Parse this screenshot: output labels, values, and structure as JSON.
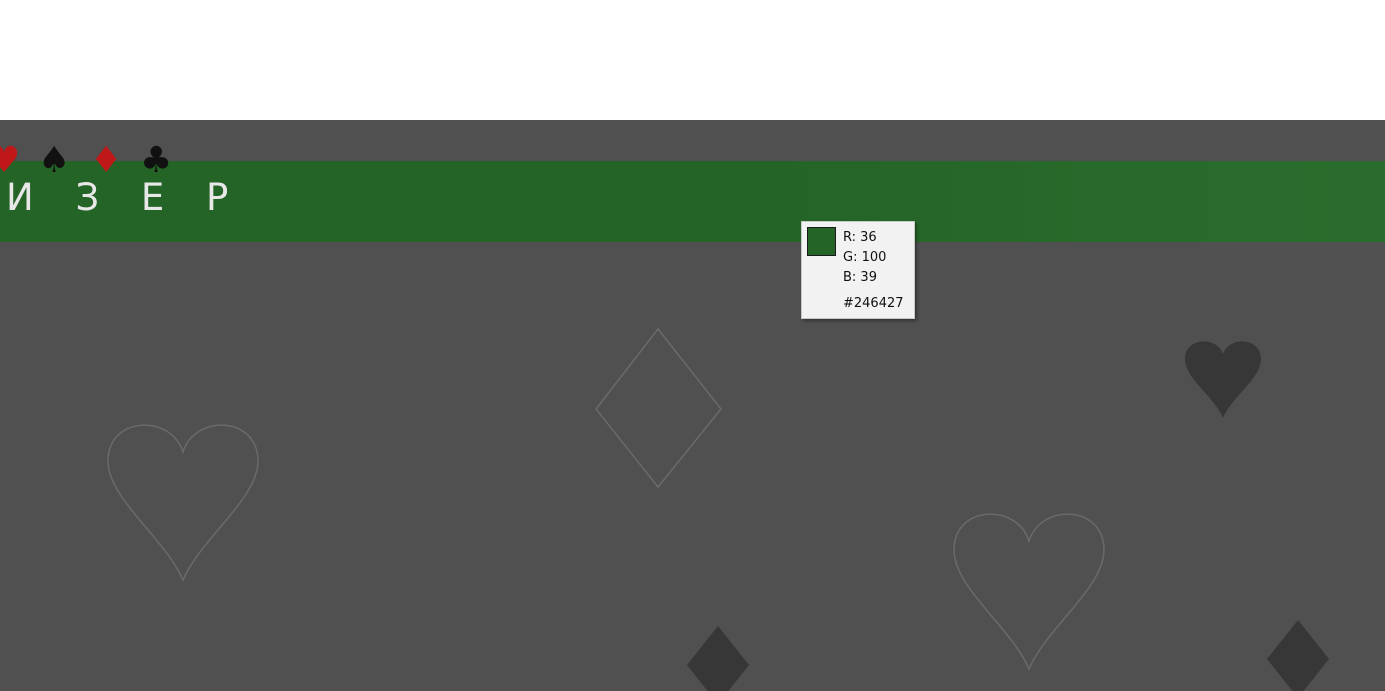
{
  "banner": {
    "title": "И З Е Р",
    "color": "#246427"
  },
  "suits_row": [
    {
      "icon": "heart-icon",
      "glyph": "♥",
      "color": "#c01818"
    },
    {
      "icon": "spade-icon",
      "glyph": "♠",
      "color": "#111111"
    },
    {
      "icon": "diamond-icon",
      "glyph": "♦",
      "color": "#c01818"
    },
    {
      "icon": "club-icon",
      "glyph": "♣",
      "color": "#111111"
    }
  ],
  "background": {
    "color": "#505050",
    "pattern_icons": [
      "heart-outline-icon",
      "diamond-outline-icon",
      "heart-outline-icon",
      "heart-icon",
      "diamond-icon",
      "diamond-icon"
    ]
  },
  "color_picker": {
    "r_label": "R: 36",
    "g_label": "G: 100",
    "b_label": "B: 39",
    "hex_label": "#246427",
    "swatch_color": "#246427"
  }
}
